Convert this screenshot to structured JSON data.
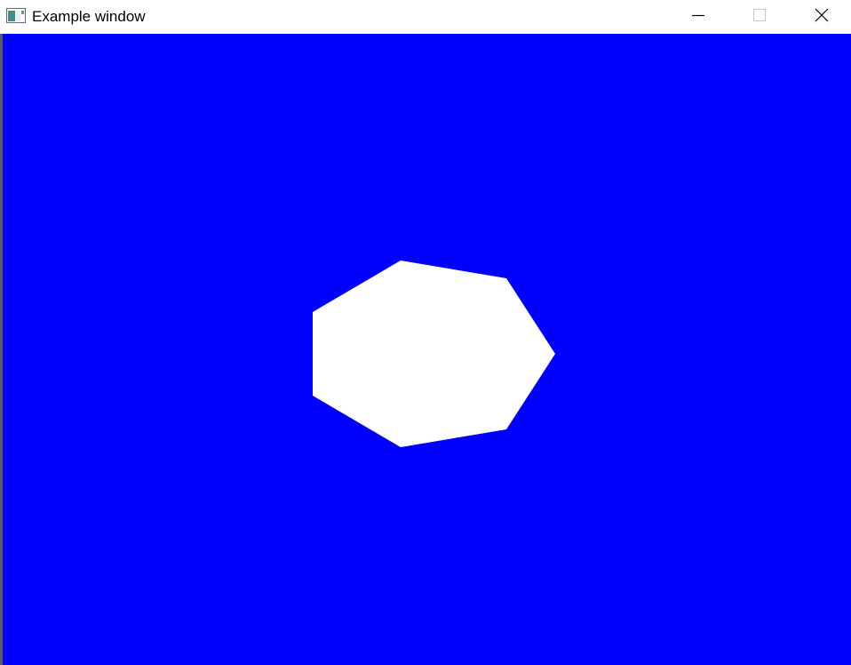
{
  "window": {
    "title": "Example window",
    "app_icon": "window-app-icon",
    "controls": {
      "minimize_icon": "minimize-icon",
      "maximize_icon": "maximize-icon",
      "close_icon": "close-icon"
    }
  },
  "canvas": {
    "background_color": "#0000ff",
    "shape": {
      "type": "heptagon",
      "fill_color": "#ffffff"
    }
  }
}
